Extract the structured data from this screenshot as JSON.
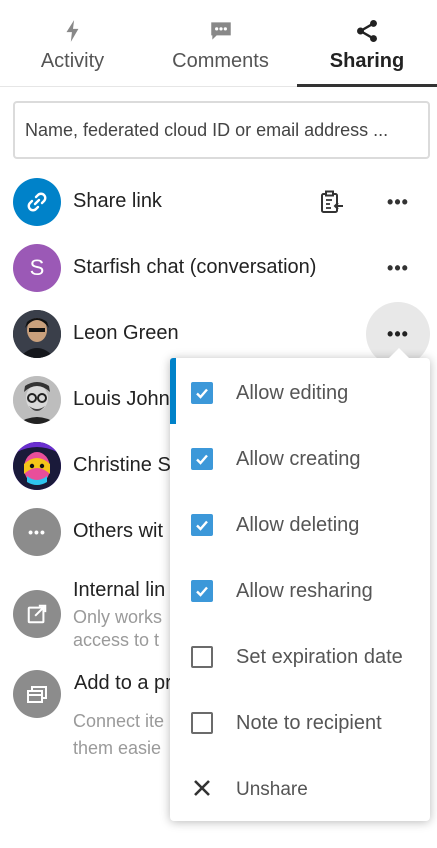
{
  "tabs": [
    {
      "label": "Activity",
      "icon": "activity-icon"
    },
    {
      "label": "Comments",
      "icon": "comments-icon"
    },
    {
      "label": "Sharing",
      "icon": "share-icon",
      "active": true
    }
  ],
  "search": {
    "placeholder": "Name, federated cloud ID or email address ..."
  },
  "share_link": {
    "label": "Share link",
    "copy_icon": "clipboard-icon",
    "menu_icon": "more-icon"
  },
  "shares": [
    {
      "name": "Starfish chat (conversation)",
      "avatar_letter": "S",
      "avatar_color": "#9b59b6"
    },
    {
      "name": "Leon Green"
    },
    {
      "name": "Louis John"
    },
    {
      "name": "Christine S"
    }
  ],
  "others": {
    "label": "Others wit"
  },
  "internal_link": {
    "title": "Internal lin",
    "desc_line1": "Only works",
    "desc_line2": "access to t"
  },
  "project": {
    "title": "Add to a pr",
    "desc_line1": "Connect ite",
    "desc_line2": "them easie"
  },
  "menu": {
    "items": [
      {
        "label": "Allow editing",
        "checked": true
      },
      {
        "label": "Allow creating",
        "checked": true
      },
      {
        "label": "Allow deleting",
        "checked": true
      },
      {
        "label": "Allow resharing",
        "checked": true
      },
      {
        "label": "Set expiration date",
        "checked": false
      },
      {
        "label": "Note to recipient",
        "checked": false
      }
    ],
    "unshare_label": "Unshare"
  },
  "colors": {
    "accent": "#0082c9",
    "checkbox": "#3c98d9",
    "muted_text": "#9a9a9a"
  }
}
